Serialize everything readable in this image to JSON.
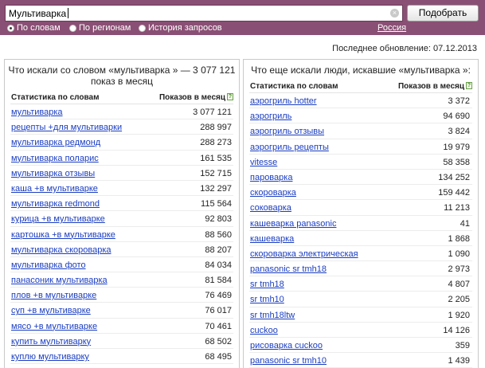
{
  "search": {
    "value": "Мультиварка",
    "clear_symbol": "×",
    "submit_label": "Подобрать"
  },
  "modes": [
    {
      "label": "По словам",
      "selected": true
    },
    {
      "label": "По регионам",
      "selected": false
    },
    {
      "label": "История запросов",
      "selected": false
    }
  ],
  "region": "Россия",
  "last_updated": "Последнее обновление: 07.12.2013",
  "left_panel": {
    "title_line1": "Что искали со словом «мультиварка » — 3 077 121",
    "title_line2": "показ в месяц",
    "col_query": "Статистика по словам",
    "col_count": "Показов в месяц",
    "help_symbol": "?",
    "rows": [
      {
        "query": "мультиварка",
        "count": "3 077 121"
      },
      {
        "query": "рецепты +для мультиварки",
        "count": "288 997"
      },
      {
        "query": "мультиварка редмонд",
        "count": "288 273"
      },
      {
        "query": "мультиварка поларис",
        "count": "161 535"
      },
      {
        "query": "мультиварка отзывы",
        "count": "152 715"
      },
      {
        "query": "каша +в мультиварке",
        "count": "132 297"
      },
      {
        "query": "мультиварка redmond",
        "count": "115 564"
      },
      {
        "query": "курица +в мультиварке",
        "count": "92 803"
      },
      {
        "query": "картошка +в мультиварке",
        "count": "88 560"
      },
      {
        "query": "мультиварка скороварка",
        "count": "88 207"
      },
      {
        "query": "мультиварка фото",
        "count": "84 034"
      },
      {
        "query": "панасоник мультиварка",
        "count": "81 584"
      },
      {
        "query": "плов +в мультиварке",
        "count": "76 469"
      },
      {
        "query": "суп +в мультиварке",
        "count": "76 017"
      },
      {
        "query": "мясо +в мультиварке",
        "count": "70 461"
      },
      {
        "query": "купить мультиварку",
        "count": "68 502"
      },
      {
        "query": "куплю мультиварку",
        "count": "68 495"
      }
    ]
  },
  "right_panel": {
    "title": "Что еще искали люди, искавшие «мультиварка »:",
    "col_query": "Статистика по словам",
    "col_count": "Показов в месяц",
    "help_symbol": "?",
    "rows": [
      {
        "query": "аэрогриль hotter",
        "count": "3 372"
      },
      {
        "query": "аэрогриль",
        "count": "94 690"
      },
      {
        "query": "аэрогриль отзывы",
        "count": "3 824"
      },
      {
        "query": "аэрогриль рецепты",
        "count": "19 979"
      },
      {
        "query": "vitesse",
        "count": "58 358"
      },
      {
        "query": "пароварка",
        "count": "134 252"
      },
      {
        "query": "скороварка",
        "count": "159 442"
      },
      {
        "query": "соковарка",
        "count": "11 213"
      },
      {
        "query": "кашеварка panasonic",
        "count": "41"
      },
      {
        "query": "кашеварка",
        "count": "1 868"
      },
      {
        "query": "скороварка электрическая",
        "count": "1 090"
      },
      {
        "query": "panasonic sr tmh18",
        "count": "2 973"
      },
      {
        "query": "sr tmh18",
        "count": "4 807"
      },
      {
        "query": "sr tmh10",
        "count": "2 205"
      },
      {
        "query": "sr tmh18ltw",
        "count": "1 920"
      },
      {
        "query": "cuckoo",
        "count": "14 126"
      },
      {
        "query": "рисоварка cuckoo",
        "count": "359"
      },
      {
        "query": "panasonic sr tmh10",
        "count": "1 439"
      }
    ]
  }
}
